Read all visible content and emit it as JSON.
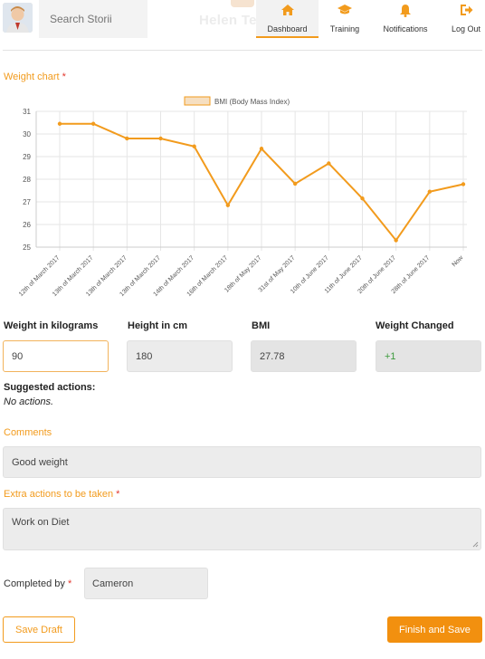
{
  "header": {
    "search_placeholder": "Search Storii",
    "user_name_ghost": "Helen Te",
    "nav": [
      {
        "label": "Dashboard",
        "icon": "home-icon"
      },
      {
        "label": "Training",
        "icon": "graduation-cap-icon"
      },
      {
        "label": "Notifications",
        "icon": "bell-icon"
      },
      {
        "label": "Log Out",
        "icon": "logout-icon"
      }
    ]
  },
  "weight_chart": {
    "label": "Weight chart",
    "required_mark": "*"
  },
  "chart_data": {
    "type": "line",
    "legend": "BMI (Body Mass Index)",
    "legend_placement": "top-center",
    "color": "#f29b1d",
    "grid": true,
    "ylim": [
      25,
      31
    ],
    "yticks": [
      25,
      26,
      27,
      28,
      29,
      30,
      31
    ],
    "categories": [
      "12th of March 2017",
      "13th of March 2017",
      "13th of March 2017",
      "13th of March 2017",
      "14th of March 2017",
      "16th of March 2017",
      "18th of May 2017",
      "31st of May 2017",
      "10th of June 2017",
      "11th of June 2017",
      "20th of June 2017",
      "28th of June 2017",
      "Now"
    ],
    "series": [
      {
        "name": "BMI (Body Mass Index)",
        "values": [
          30.45,
          30.45,
          29.8,
          29.8,
          29.45,
          26.85,
          29.35,
          27.8,
          28.7,
          27.15,
          25.3,
          27.45,
          27.78
        ]
      }
    ]
  },
  "fields": {
    "weight": {
      "label": "Weight in kilograms",
      "value": "90"
    },
    "height": {
      "label": "Height in cm",
      "value": "180"
    },
    "bmi": {
      "label": "BMI",
      "value": "27.78"
    },
    "weight_changed": {
      "label": "Weight Changed",
      "value": "+1"
    }
  },
  "suggested": {
    "label": "Suggested actions:",
    "value": "No actions."
  },
  "comments": {
    "label": "Comments",
    "value": "Good weight"
  },
  "extra_actions": {
    "label": "Extra actions to be taken",
    "required_mark": "*",
    "value": "Work on Diet"
  },
  "completed_by": {
    "label": "Completed by",
    "required_mark": "*",
    "value": "Cameron"
  },
  "buttons": {
    "save_draft": "Save Draft",
    "finish_save": "Finish and Save"
  }
}
